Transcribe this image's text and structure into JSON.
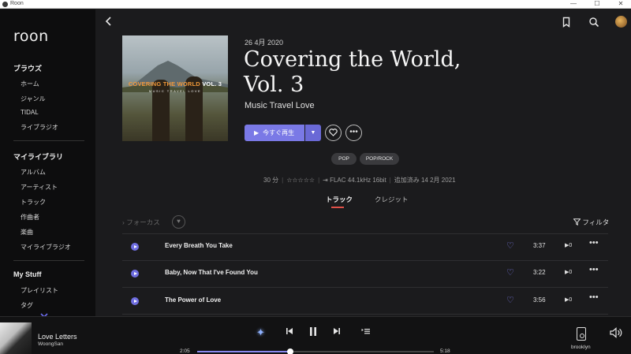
{
  "window": {
    "title": "Roon",
    "controls": [
      "—",
      "☐",
      "✕"
    ]
  },
  "sidebar": {
    "logo": "roon",
    "sections": [
      {
        "heading": "ブラウズ",
        "items": [
          "ホーム",
          "ジャンル",
          "TIDAL",
          "ライブラジオ"
        ]
      },
      {
        "heading": "マイライブラリ",
        "items": [
          "アルバム",
          "アーティスト",
          "トラック",
          "作曲者",
          "楽曲",
          "マイライブラジオ"
        ]
      },
      {
        "heading": "My Stuff",
        "items": [
          "プレイリスト",
          "タグ"
        ]
      }
    ],
    "more_icon": "chevron-down-icon"
  },
  "header": {
    "back_icon": "chevron-left-icon",
    "icons": [
      "bookmark-icon",
      "search-icon",
      "user-avatar"
    ]
  },
  "album": {
    "cover": {
      "title_part1": "COVERING THE WORLD",
      "title_part2": "VOL. 3",
      "subtitle": "MUSIC TRAVEL LOVE"
    },
    "date": "26 4月 2020",
    "title_line1": "Covering the World,",
    "title_line2": "Vol. 3",
    "artist": "Music Travel Love",
    "play_label": "今すぐ再生",
    "tags": [
      "POP",
      "POP/ROCK"
    ],
    "meta": {
      "duration": "30 分",
      "rating": "☆☆☆☆☆",
      "format": "FLAC 44.1kHz 16bit",
      "added": "追加済み 14 2月 2021"
    },
    "tabs": [
      "トラック",
      "クレジット"
    ],
    "active_tab": 0
  },
  "tracklist": {
    "focus_label": "フォーカス",
    "filter_label": "フィルタ",
    "tracks": [
      {
        "title": "Every Breath You Take",
        "duration": "3:37",
        "plays": "0"
      },
      {
        "title": "Baby, Now That I've Found You",
        "duration": "3:22",
        "plays": "0"
      },
      {
        "title": "The Power of Love",
        "duration": "3:56",
        "plays": "0"
      }
    ]
  },
  "player": {
    "now_playing_title": "Love Letters",
    "now_playing_artist": "WoongSan",
    "time_elapsed": "2:05",
    "time_total": "5:18",
    "progress": 0.393,
    "zone": "brooklyn",
    "accent_color": "#7a79e6"
  }
}
